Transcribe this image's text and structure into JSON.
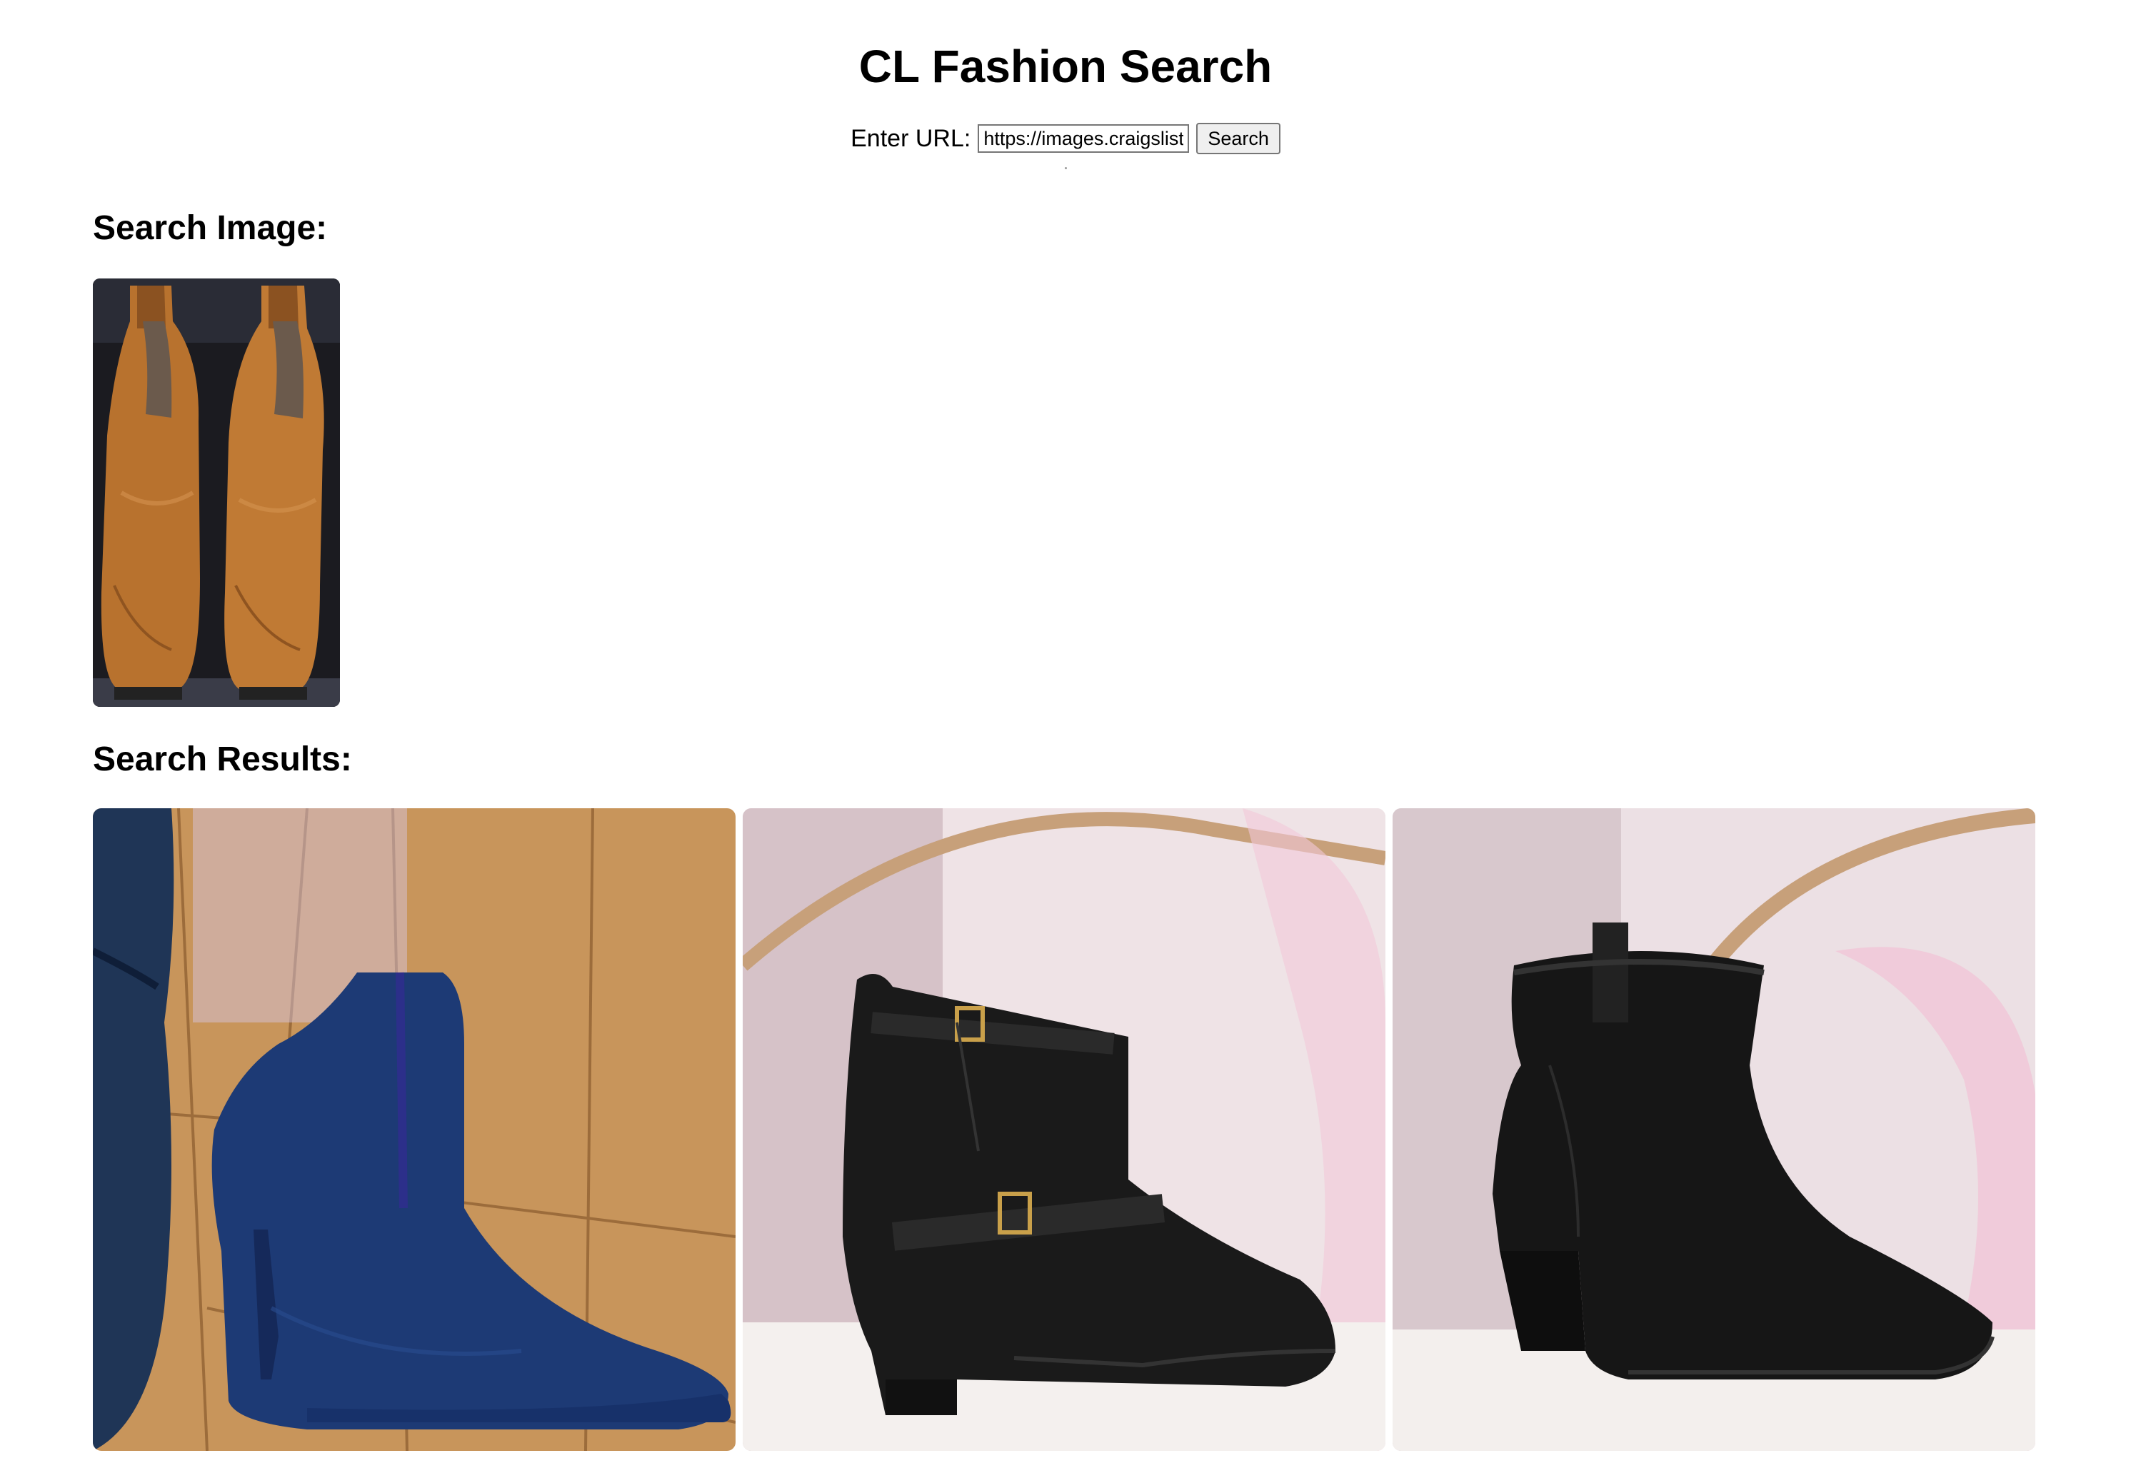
{
  "header": {
    "title": "CL Fashion Search"
  },
  "form": {
    "url_label": "Enter URL:",
    "url_value": "https://images.craigslist",
    "search_button_label": "Search"
  },
  "query": {
    "heading": "Search Image:",
    "image_icon": "tan-leather-chelsea-boots-photo"
  },
  "results": {
    "heading": "Search Results:",
    "items": [
      {
        "image_icon": "blue-suede-high-heel-ankle-boot-photo"
      },
      {
        "image_icon": "black-leather-buckle-ankle-boot-photo"
      },
      {
        "image_icon": "black-leather-block-heel-ankle-boot-photo"
      }
    ]
  },
  "colors": {
    "background": "#ffffff",
    "text": "#000000",
    "button_bg": "#efefef",
    "border": "#767676"
  }
}
